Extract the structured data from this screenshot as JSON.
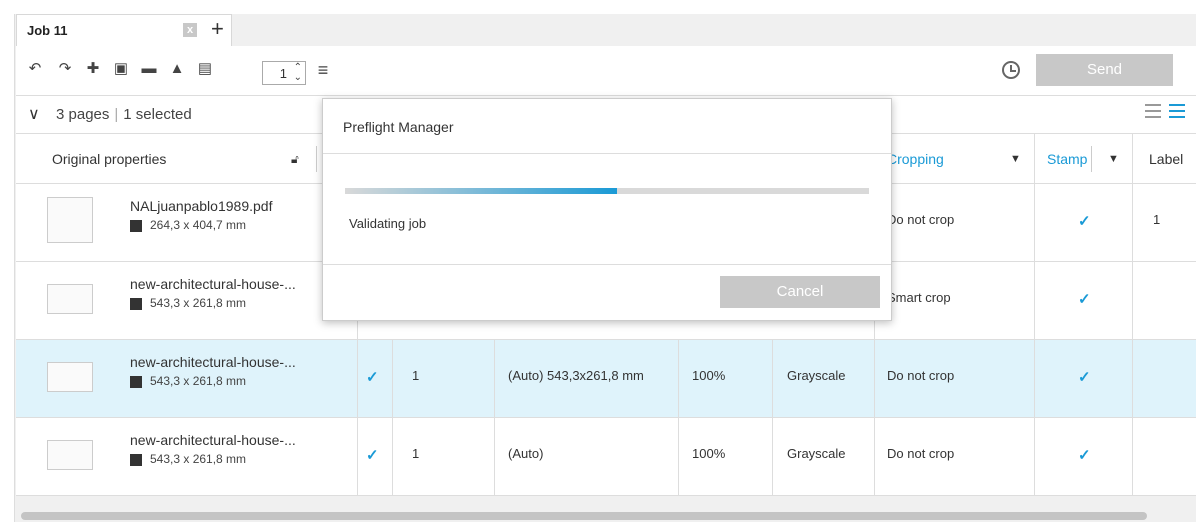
{
  "tab": {
    "title": "Job 11",
    "close": "x",
    "add": "+"
  },
  "toolbar": {
    "copies": "1",
    "send_label": "Send"
  },
  "summary": {
    "pages": "3 pages",
    "selected": "1 selected"
  },
  "columns": {
    "original": "Original properties",
    "cropping": "Cropping",
    "stamp": "Stamp",
    "label": "Label"
  },
  "rows": [
    {
      "name": "NALjuanpablo1989.pdf",
      "size": "264,3 x 404,7 mm",
      "cropping": "Do not crop",
      "stamp": "✓",
      "label": "1"
    },
    {
      "name": "new-architectural-house-...",
      "size": "543,3 x 261,8 mm",
      "cropping": "Smart crop",
      "stamp": "✓"
    },
    {
      "name": "new-architectural-house-...",
      "size": "543,3 x 261,8 mm",
      "check": "✓",
      "copies": "1",
      "media": "(Auto) 543,3x261,8 mm",
      "scale": "100%",
      "color": "Grayscale",
      "cropping": "Do not crop",
      "stamp": "✓"
    },
    {
      "name": "new-architectural-house-...",
      "size": "543,3 x 261,8 mm",
      "check": "✓",
      "copies": "1",
      "media": "(Auto)",
      "scale": "100%",
      "color": "Grayscale",
      "cropping": "Do not crop",
      "stamp": "✓"
    }
  ],
  "dialog": {
    "title": "Preflight Manager",
    "status": "Validating job",
    "cancel_label": "Cancel",
    "progress": 0.52
  },
  "colors": {
    "accent": "#1a9ad6",
    "selected_row": "#dff3fb",
    "disabled_button": "#c8c8c8"
  }
}
